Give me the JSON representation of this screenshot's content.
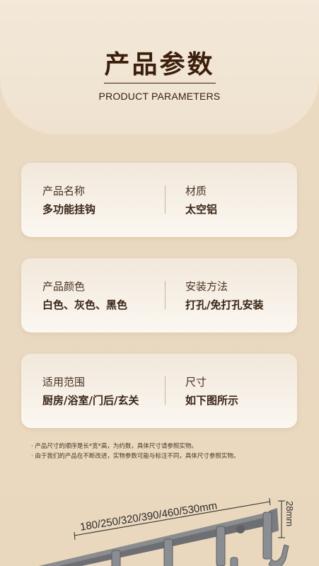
{
  "header": {
    "title": "产品参数",
    "subtitle": "PRODUCT PARAMETERS"
  },
  "params": [
    {
      "left": {
        "label": "产品名称",
        "value": "多功能挂钩"
      },
      "right": {
        "label": "材质",
        "value": "太空铝"
      }
    },
    {
      "left": {
        "label": "产品颜色",
        "value": "白色、灰色、黑色"
      },
      "right": {
        "label": "安装方法",
        "value": "打孔/免打孔安装"
      }
    },
    {
      "left": {
        "label": "适用范围",
        "value": "厨房/浴室/门后/玄关"
      },
      "right": {
        "label": "尺寸",
        "value": "如下图所示"
      }
    }
  ],
  "notes": {
    "note1": "· 产品尺寸的顺序是长*宽*高，为约数，具体尺寸请参照实物。",
    "note2": "· 由于我们的产品在不断改进，实物参数可能与标注不同，具体尺寸参照实物。"
  },
  "product": {
    "length_label": "180/250/320/390/460/530mm",
    "height_label": "28mm",
    "color": "#6d6f73"
  }
}
